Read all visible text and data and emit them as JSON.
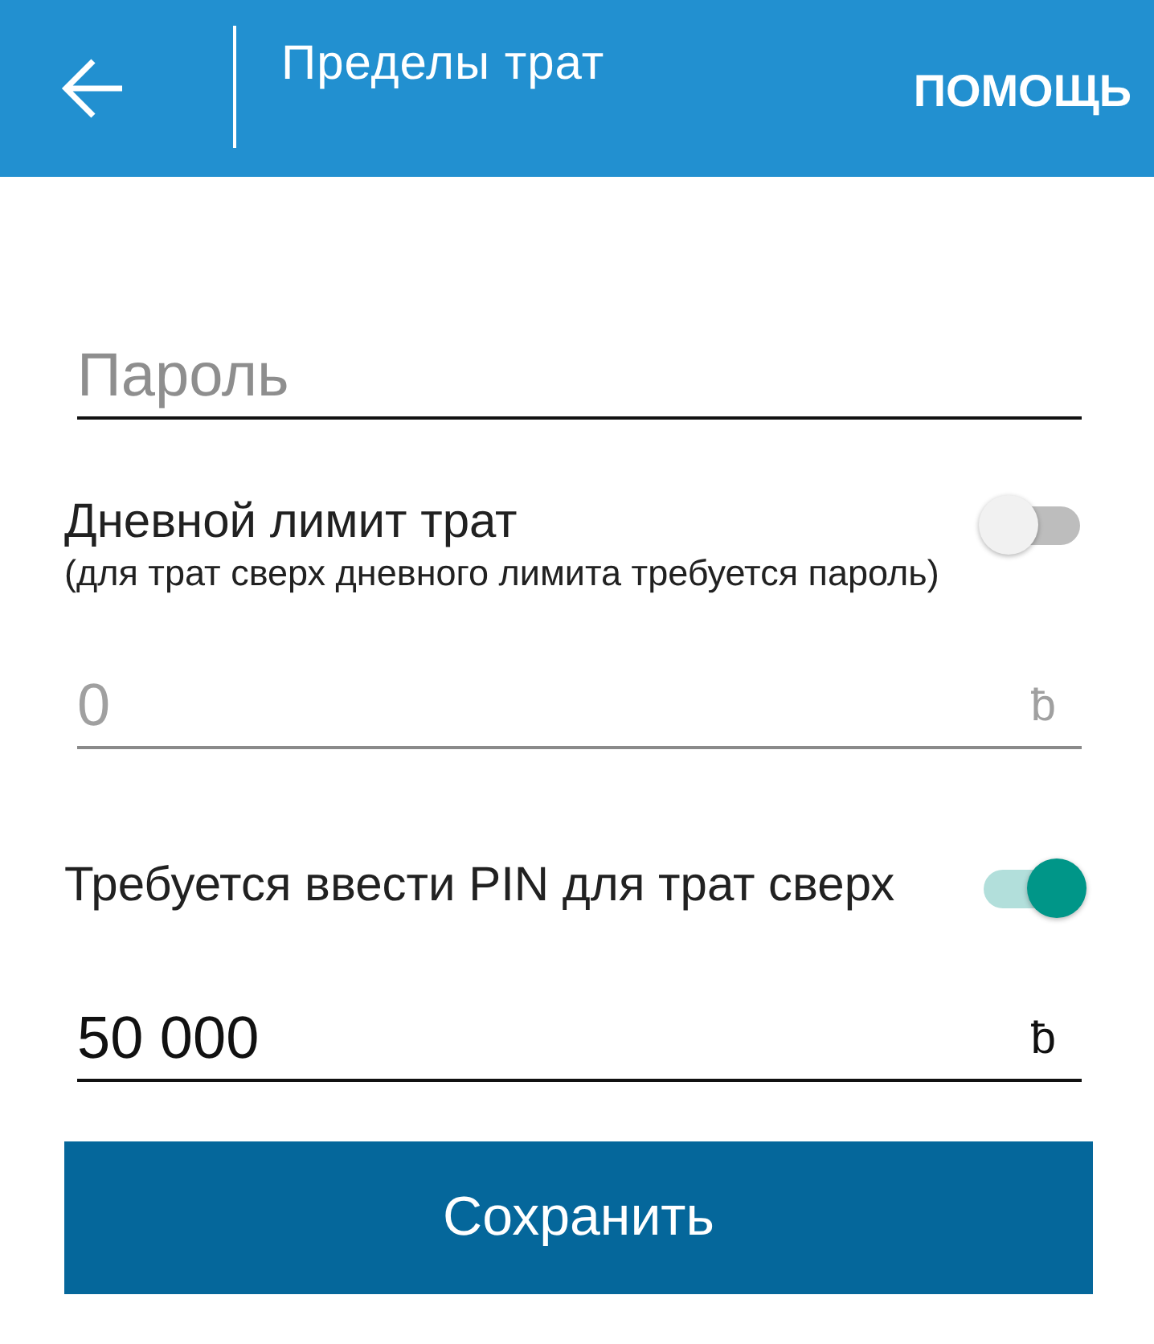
{
  "header": {
    "title": "Пределы трат",
    "action": "ПОМОЩЬ"
  },
  "password_field": {
    "placeholder": "Пароль"
  },
  "settings": [
    {
      "kind": "toggle",
      "label": "Дневной лимит трат",
      "hint": "(для трат сверх дневного лимита требуется пароль)",
      "on": false
    },
    {
      "kind": "amount",
      "value": "0",
      "currency": "ƀ",
      "disabled": true
    },
    {
      "kind": "toggle",
      "label": "Требуется ввести PIN для трат сверх",
      "on": true
    },
    {
      "kind": "amount",
      "value": "50 000",
      "currency": "ƀ",
      "disabled": false
    }
  ],
  "save_button": {
    "label": "Сохранить"
  }
}
